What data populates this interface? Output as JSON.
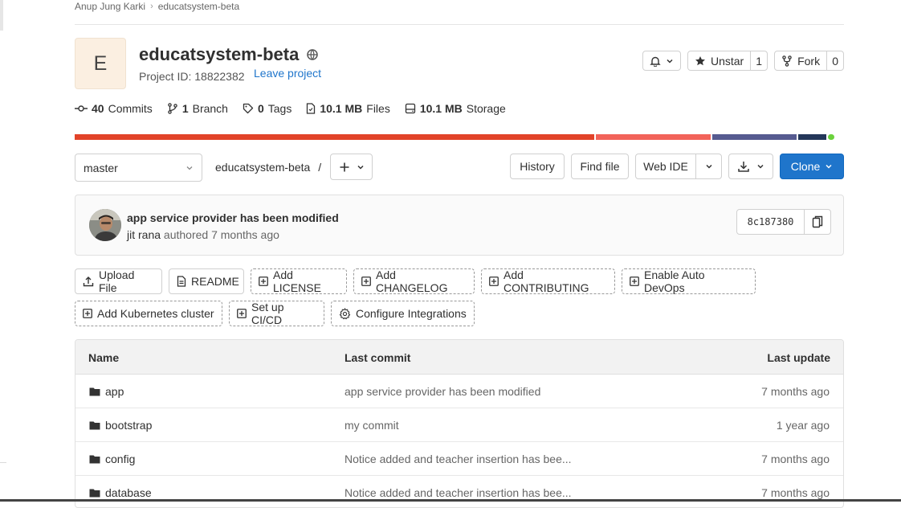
{
  "breadcrumb": {
    "owner": "Anup Jung Karki",
    "project": "educatsystem-beta"
  },
  "project": {
    "avatar_letter": "E",
    "name": "educatsystem-beta",
    "id_text": "Project ID: 18822382",
    "leave_label": "Leave project"
  },
  "actions": {
    "unstar_label": "Unstar",
    "star_count": "1",
    "fork_label": "Fork",
    "fork_count": "0"
  },
  "stats": {
    "commits_count": "40",
    "commits_label": "Commits",
    "branch_count": "1",
    "branch_label": "Branch",
    "tags_count": "0",
    "tags_label": "Tags",
    "files_size": "10.1 MB",
    "files_label": "Files",
    "storage_size": "10.1 MB",
    "storage_label": "Storage"
  },
  "language_bar": [
    {
      "fraction": 0.687,
      "color": "#e24329"
    },
    {
      "fraction": 0.152,
      "color": "#f2635a"
    },
    {
      "fraction": 0.111,
      "color": "#565b90"
    },
    {
      "fraction": 0.037,
      "color": "#24375a"
    },
    {
      "fraction": 0.008,
      "color": "#6bd23c"
    }
  ],
  "toolbar": {
    "branch": "master",
    "path": "educatsystem-beta",
    "path_sep": "/",
    "history": "History",
    "find_file": "Find file",
    "web_ide": "Web IDE",
    "clone": "Clone"
  },
  "last_commit": {
    "title": "app service provider has been modified",
    "author": "jit rana",
    "meta": "authored 7 months ago",
    "sha": "8c187380"
  },
  "quick_actions": {
    "upload": "Upload File",
    "readme": "README",
    "license": "Add LICENSE",
    "changelog": "Add CHANGELOG",
    "contributing": "Add CONTRIBUTING",
    "autodevops": "Enable Auto DevOps",
    "kubernetes": "Add Kubernetes cluster",
    "cicd": "Set up CI/CD",
    "integrations": "Configure Integrations"
  },
  "files": {
    "headers": {
      "name": "Name",
      "commit": "Last commit",
      "update": "Last update"
    },
    "rows": [
      {
        "name": "app",
        "commit": "app service provider has been modified",
        "update": "7 months ago"
      },
      {
        "name": "bootstrap",
        "commit": "my commit",
        "update": "1 year ago"
      },
      {
        "name": "config",
        "commit": "Notice added and teacher insertion has bee...",
        "update": "7 months ago"
      },
      {
        "name": "database",
        "commit": "Notice added and teacher insertion has bee...",
        "update": "7 months ago"
      }
    ]
  }
}
